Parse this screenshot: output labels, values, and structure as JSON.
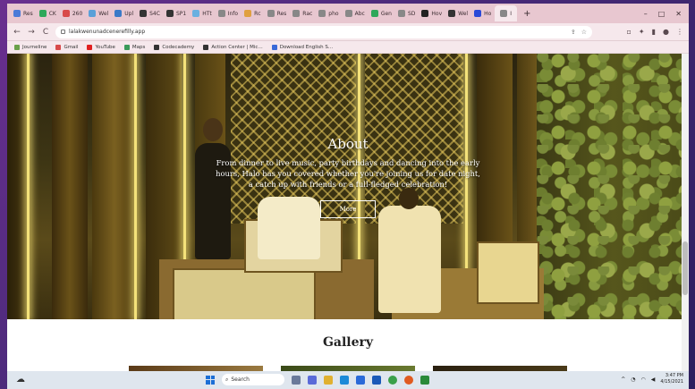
{
  "browser": {
    "tabs": [
      {
        "label": "Res",
        "color": "#4a7ad8"
      },
      {
        "label": "CK",
        "color": "#2ea85a"
      },
      {
        "label": "260",
        "color": "#d84a4a"
      },
      {
        "label": "Wel",
        "color": "#5aa0d8"
      },
      {
        "label": "Upl",
        "color": "#3a7ac8"
      },
      {
        "label": "S4C",
        "color": "#333333"
      },
      {
        "label": "SP1",
        "color": "#333333"
      },
      {
        "label": "HTt",
        "color": "#6ab0e0"
      },
      {
        "label": "Info",
        "color": "#888888"
      },
      {
        "label": "Rc",
        "color": "#e0a040"
      },
      {
        "label": "Res",
        "color": "#888888"
      },
      {
        "label": "Rac",
        "color": "#888888"
      },
      {
        "label": "pho",
        "color": "#888888"
      },
      {
        "label": "Abc",
        "color": "#888888"
      },
      {
        "label": "Gen",
        "color": "#2ea85a"
      },
      {
        "label": "SD",
        "color": "#888888"
      },
      {
        "label": "Hov",
        "color": "#222222"
      },
      {
        "label": "Wel",
        "color": "#333333"
      },
      {
        "label": "Ho",
        "color": "#2a4ad8"
      },
      {
        "label": "I",
        "color": "#888888"
      }
    ],
    "new_tab": "+",
    "window_controls": [
      "–",
      "□",
      "✕"
    ],
    "nav": {
      "back": "←",
      "forward": "→",
      "reload": "C"
    },
    "url": "lalakwenunadcenerefilly.app",
    "bookmarks": [
      {
        "label": "Journeline",
        "color": "#6aa04a"
      },
      {
        "label": "Gmail",
        "color": "#d84a4a"
      },
      {
        "label": "YouTube",
        "color": "#e02020"
      },
      {
        "label": "Maps",
        "color": "#3a9a5a"
      },
      {
        "label": "Codecademy",
        "color": "#333333"
      },
      {
        "label": "Action Center | Mic...",
        "color": "#333333"
      },
      {
        "label": "Download English S...",
        "color": "#3a6ad8"
      }
    ]
  },
  "hero": {
    "title": "About",
    "text": "From dinner to live music, party birthdays and dancing into the early hours, Halo has you covered whether you're joining us for date night, a catch up with friends or a full-fledged celebration!",
    "button": "More"
  },
  "gallery": {
    "title": "Gallery"
  },
  "taskbar": {
    "search": "Search",
    "time": "3:47 PM",
    "date": "4/15/2021"
  }
}
